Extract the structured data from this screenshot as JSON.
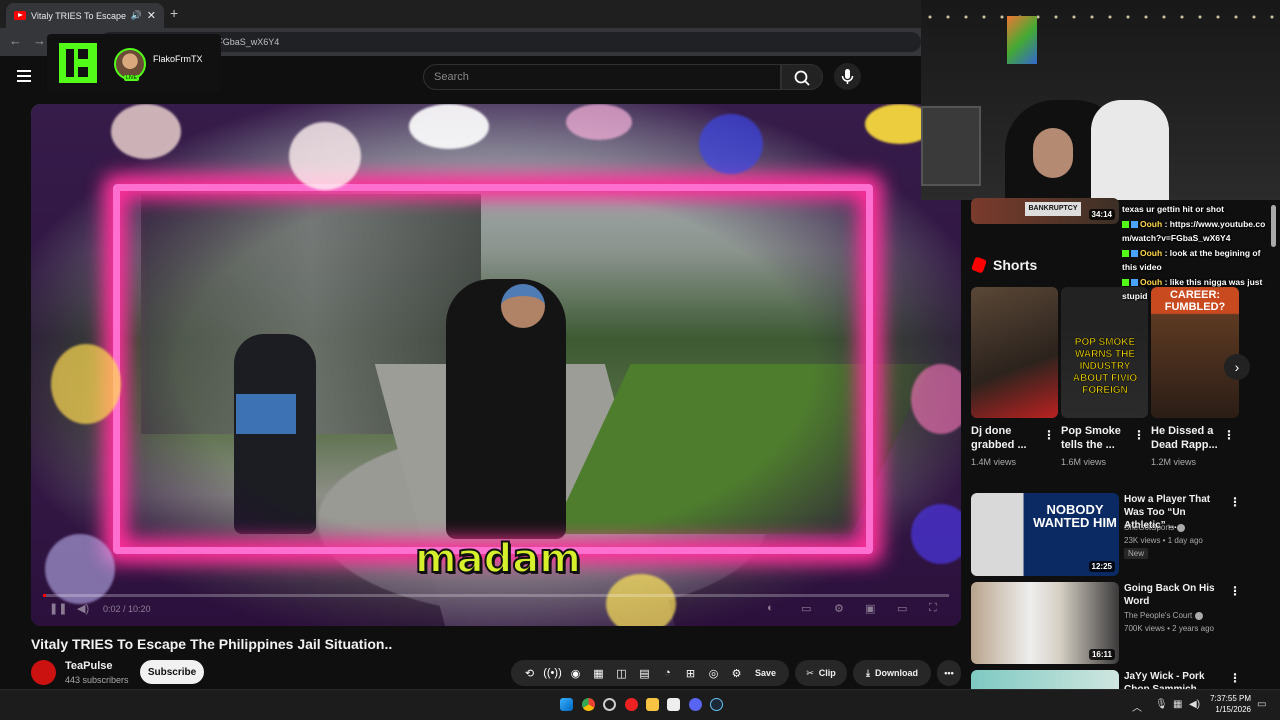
{
  "browser": {
    "tab_title": "Vitaly TRIES To Escape The P",
    "new_tab": "+",
    "url": "=FGbaS_wX6Y4"
  },
  "kick": {
    "streamer": "FlakoFrmTX",
    "live_label": "LIVE",
    "colors": {
      "brand": "#53fc18"
    }
  },
  "youtube": {
    "search_placeholder": "Search",
    "video": {
      "caption": "madam",
      "time": "0:02 / 10:20",
      "progress_fraction": 0.003
    },
    "title": "Vitaly TRIES To Escape The Philippines Jail Situation..",
    "channel": {
      "name": "TeaPulse",
      "subscribers": "443 subscribers"
    },
    "subscribe_label": "Subscribe",
    "actions": {
      "save": "Save",
      "clip": "Clip",
      "download": "Download"
    },
    "sidebar": {
      "top_duration": "34:14",
      "top_thumb_text": "BANKRUPTCY",
      "shorts_title": "Shorts",
      "shorts": [
        {
          "title": "Dj done grabbed ...",
          "views": "1.4M views",
          "thumb": ""
        },
        {
          "title": "Pop Smoke tells the ...",
          "views": "1.6M views",
          "thumb": "POP SMOKE WARNS THE INDUSTRY ABOUT FIVIO FOREIGN"
        },
        {
          "title": "He Dissed a Dead Rapp...",
          "views": "1.2M views",
          "thumb": "CAREER: FUMBLED?"
        }
      ],
      "recommendations": [
        {
          "title": "How a Player That Was Too “Un Athletic” ...",
          "channel": "SheGotSports",
          "meta": "23K views • 1 day ago",
          "badge": "New",
          "duration": "12:25",
          "thumb": "NOBODY WANTED HIM"
        },
        {
          "title": "Going Back On His Word",
          "channel": "The People's Court",
          "meta": "700K views • 2 years ago",
          "duration": "16:11"
        },
        {
          "title": "JaYy Wick - Pork Chop Sammich (Official",
          "channel": "",
          "meta": ""
        }
      ]
    }
  },
  "chat": [
    {
      "user": "",
      "text": "texas ur gettin hit or shot"
    },
    {
      "user": "Oouh",
      "text": "https://www.youtube.com/watch?v=FGbaS_wX6Y4"
    },
    {
      "user": "Oouh",
      "text": "look at the begining of this video"
    },
    {
      "user": "Oouh",
      "text": "like this nigga was just stupid"
    }
  ],
  "taskbar": {
    "time": "7:37:55 PM",
    "date": "1/15/2026"
  }
}
